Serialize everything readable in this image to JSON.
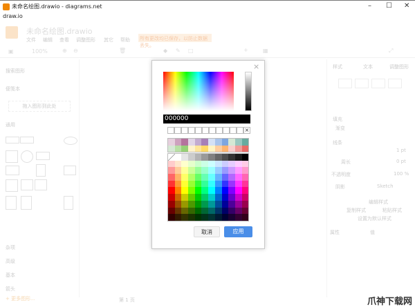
{
  "window": {
    "title": "未命名绘图.drawio - diagrams.net",
    "menu": "draw.io",
    "minimize": "–",
    "maximize": "☐",
    "close": "✕"
  },
  "app": {
    "doc_name": "未命名绘图.drawio",
    "menus": [
      "文件",
      "编辑",
      "查看",
      "调整图形",
      "其它",
      "帮助"
    ],
    "notice": "所有更改均已保存，以防止数据丢失。",
    "zoom": "100%"
  },
  "sidebar": {
    "search_placeholder": "搜索图形",
    "scratchpad": "便笺本",
    "drop_hint": "拖入图形到此处",
    "general": "通用",
    "sections": [
      "杂项",
      "高级",
      "基本",
      "箭头"
    ],
    "more": "+ 更多图形..."
  },
  "right_panel": {
    "tabs": [
      "样式",
      "文本",
      "调整图形"
    ],
    "fill": "填充",
    "gradient": "渐变",
    "line": "线条",
    "opacity_label": "不透明度",
    "opacity": "100 %",
    "line_width": "1 pt",
    "perimeter": "0 pt",
    "perimeter_label": "周长",
    "shadow": "阴影",
    "sketch": "Sketch",
    "edit_style": "编辑样式",
    "copy_style": "复制样式",
    "paste_style": "粘贴样式",
    "set_default": "设置为默认样式",
    "property": "属性",
    "value": "值"
  },
  "status": {
    "page": "第 1 页"
  },
  "dialog": {
    "hex_value": "000000",
    "cancel": "取消",
    "apply": "应用",
    "close": "×",
    "preset_row1": [
      "#E6D0DE",
      "#CDA2BE",
      "#B5739D",
      "#E1D5E7",
      "#C3ABD0",
      "#A680B8",
      "#D4E1F5",
      "#A9C4EB",
      "#7EA6E0",
      "#D5E8D4",
      "#9AC7BF",
      "#67AB9F"
    ],
    "preset_row2": [
      "#D5E8D4",
      "#B9E0A5",
      "#97D077",
      "#FFF2CC",
      "#FFE599",
      "#FFD966",
      "#FFF4C3",
      "#FFCE9F",
      "#FFB570",
      "#F8CECC",
      "#F19C99",
      "#EA6B66"
    ],
    "gray_row": [
      "none",
      "#FFFFFF",
      "#E6E6E6",
      "#CCCCCC",
      "#B3B3B3",
      "#999999",
      "#808080",
      "#666666",
      "#4D4D4D",
      "#333333",
      "#1A1A1A",
      "#000000"
    ],
    "hues": [
      0,
      30,
      60,
      90,
      120,
      150,
      180,
      210,
      240,
      270,
      300,
      330
    ],
    "lightness": [
      90,
      80,
      70,
      60,
      50,
      40,
      30,
      20,
      10
    ]
  },
  "watermark": "爪神下载网"
}
